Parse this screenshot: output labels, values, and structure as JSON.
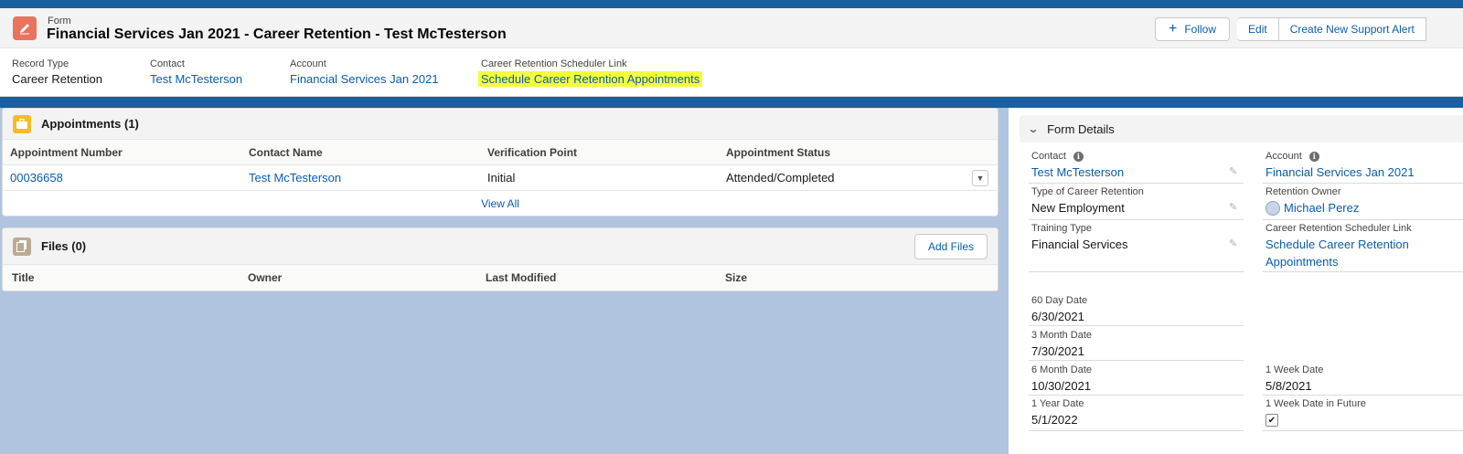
{
  "header": {
    "object_label": "Form",
    "title": "Financial Services Jan 2021 - Career Retention - Test McTesterson",
    "buttons": {
      "follow": "Follow",
      "edit": "Edit",
      "create_alert": "Create New Support Alert"
    },
    "fields": [
      {
        "label": "Record Type",
        "value": "Career Retention"
      },
      {
        "label": "Contact",
        "value": "Test McTesterson"
      },
      {
        "label": "Account",
        "value": "Financial Services Jan 2021"
      },
      {
        "label": "Career Retention Scheduler Link",
        "value": "Schedule Career Retention Appointments"
      }
    ]
  },
  "appointments": {
    "title": "Appointments (1)",
    "columns": [
      "Appointment Number",
      "Contact Name",
      "Verification Point",
      "Appointment Status"
    ],
    "rows": [
      {
        "number": "00036658",
        "contact": "Test McTesterson",
        "verification": "Initial",
        "status": "Attended/Completed"
      }
    ],
    "view_all": "View All"
  },
  "files": {
    "title": "Files (0)",
    "add_button": "Add Files",
    "columns": [
      "Title",
      "Owner",
      "Last Modified",
      "Size"
    ]
  },
  "details": {
    "title": "Form Details",
    "contact_label": "Contact",
    "contact_value": "Test McTesterson",
    "account_label": "Account",
    "account_value": "Financial Services Jan 2021",
    "type_label": "Type of Career Retention",
    "type_value": "New Employment",
    "owner_label": "Retention Owner",
    "owner_value": "Michael Perez",
    "training_label": "Training Type",
    "training_value": "Financial Services",
    "scheduler_label": "Career Retention Scheduler Link",
    "scheduler_line1": "Schedule Career Retention",
    "scheduler_line2": "Appointments",
    "d60_label": "60 Day Date",
    "d60_value": "6/30/2021",
    "m3_label": "3 Month Date",
    "m3_value": "7/30/2021",
    "m6_label": "6 Month Date",
    "m6_value": "10/30/2021",
    "w1_label": "1 Week Date",
    "w1_value": "5/8/2021",
    "y1_label": "1 Year Date",
    "y1_value": "5/1/2022",
    "w1f_label": "1 Week Date in Future",
    "w1f_checked": true
  }
}
